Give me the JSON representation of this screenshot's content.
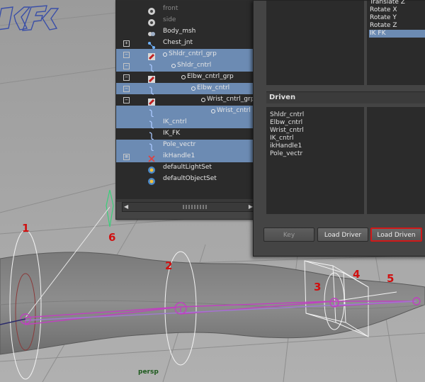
{
  "outliner": {
    "items": [
      {
        "label": "front",
        "dim": true,
        "selected": false,
        "expander": "",
        "icon": "camera-icon"
      },
      {
        "label": "side",
        "dim": true,
        "selected": false,
        "expander": "",
        "icon": "camera-icon"
      },
      {
        "label": "Body_msh",
        "dim": false,
        "selected": false,
        "expander": "",
        "icon": "mesh-icon"
      },
      {
        "label": "Chest_jnt",
        "dim": false,
        "selected": false,
        "expander": "+",
        "icon": "joint-icon"
      },
      {
        "label": "Shldr_cntrl_grp",
        "dim": false,
        "selected": true,
        "expander": "−",
        "icon": "group-icon"
      },
      {
        "label": "Shldr_cntrl",
        "dim": false,
        "selected": true,
        "expander": "−",
        "icon": "curve-icon"
      },
      {
        "label": "Elbw_cntrl_grp",
        "dim": false,
        "selected": false,
        "expander": "−",
        "icon": "group-icon"
      },
      {
        "label": "Elbw_cntrl",
        "dim": false,
        "selected": true,
        "expander": "−",
        "icon": "curve-icon"
      },
      {
        "label": "Wrist_cntrl_grp",
        "dim": false,
        "selected": false,
        "expander": "−",
        "icon": "group-icon"
      },
      {
        "label": "Wrist_cntrl",
        "dim": false,
        "selected": true,
        "expander": "",
        "icon": "curve-icon"
      },
      {
        "label": "IK_cntrl",
        "dim": false,
        "selected": true,
        "expander": "",
        "icon": "curve-icon"
      },
      {
        "label": "IK_FK",
        "dim": false,
        "selected": false,
        "expander": "",
        "icon": "curve-icon"
      },
      {
        "label": "Pole_vectr",
        "dim": false,
        "selected": true,
        "expander": "",
        "icon": "curve-icon"
      },
      {
        "label": "ikHandle1",
        "dim": false,
        "selected": true,
        "expander": "⊞",
        "icon": "ik-handle-icon"
      },
      {
        "label": "defaultLightSet",
        "dim": false,
        "selected": false,
        "expander": "",
        "icon": "set-icon"
      },
      {
        "label": "defaultObjectSet",
        "dim": false,
        "selected": false,
        "expander": "",
        "icon": "set-icon"
      }
    ]
  },
  "driver": {
    "attributes": [
      {
        "label": "Translate Z",
        "selected": false
      },
      {
        "label": "Rotate X",
        "selected": false
      },
      {
        "label": "Rotate Y",
        "selected": false
      },
      {
        "label": "Rotate Z",
        "selected": false
      },
      {
        "label": "IK FK",
        "selected": true
      }
    ]
  },
  "driven": {
    "title": "Driven",
    "objects": [
      "Shldr_cntrl",
      "Elbw_cntrl",
      "Wrist_cntrl",
      "IK_cntrl",
      "ikHandle1",
      "Pole_vectr"
    ]
  },
  "buttons": {
    "key": "Key",
    "load_driver": "Load Driver",
    "load_driven": "Load Driven"
  },
  "viewport": {
    "camera": "persp",
    "callouts": [
      "1",
      "2",
      "3",
      "4",
      "5",
      "6"
    ]
  },
  "colors": {
    "selection": "#6c8bb3",
    "callout": "#d01010",
    "joint_chain": "#c040c0",
    "highlight_border": "#d01818"
  }
}
